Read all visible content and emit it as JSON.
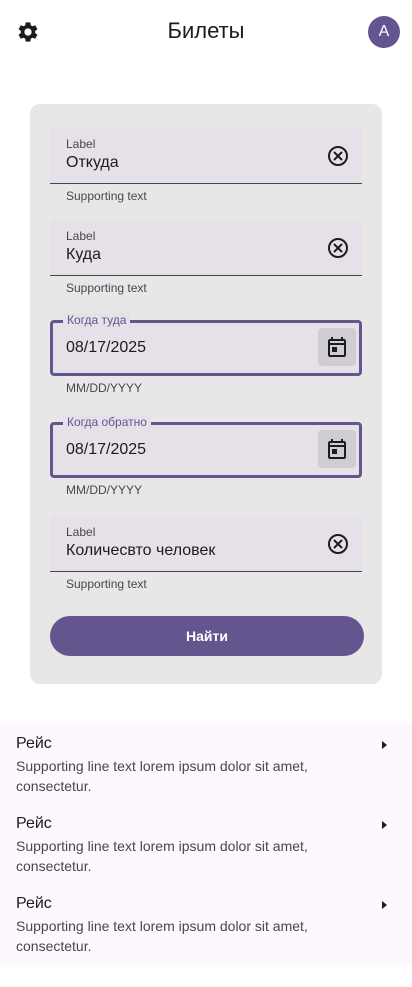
{
  "header": {
    "title": "Билеты",
    "avatar_initial": "A",
    "settings_icon": "gear-icon"
  },
  "form": {
    "from": {
      "label": "Label",
      "value": "Откуда",
      "supporting": "Supporting text",
      "icon": "clear-icon"
    },
    "to": {
      "label": "Label",
      "value": "Куда",
      "supporting": "Supporting text",
      "icon": "clear-icon"
    },
    "depart": {
      "label": "Когда туда",
      "value": "08/17/2025",
      "supporting": "MM/DD/YYYY",
      "icon": "calendar-icon"
    },
    "return": {
      "label": "Когда обратно",
      "value": "08/17/2025",
      "supporting": "MM/DD/YYYY",
      "icon": "calendar-icon"
    },
    "people": {
      "label": "Label",
      "value": "Количесвто человек",
      "supporting": "Supporting text",
      "icon": "clear-icon"
    },
    "search_label": "Найти"
  },
  "flights": [
    {
      "title": "Рейс",
      "subtitle": "Supporting line text lorem ipsum dolor sit amet, consectetur."
    },
    {
      "title": "Рейс",
      "subtitle": "Supporting line text lorem ipsum dolor sit amet, consectetur."
    },
    {
      "title": "Рейс",
      "subtitle": "Supporting line text lorem ipsum dolor sit amet, consectetur."
    }
  ],
  "colors": {
    "primary": "#65558f",
    "field_bg": "#e6e0e9",
    "card_bg": "#e7e7e7",
    "list_bg": "#fdf7fe"
  }
}
